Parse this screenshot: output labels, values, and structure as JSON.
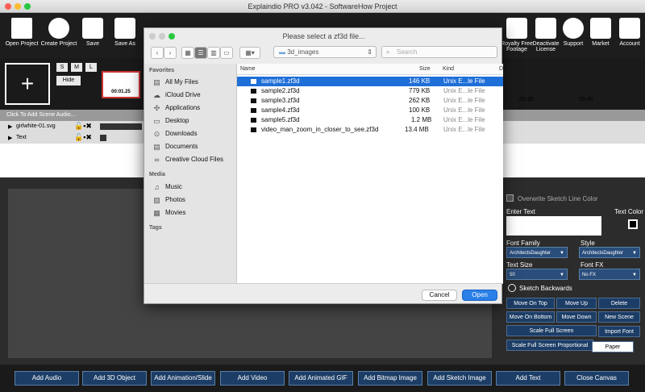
{
  "window": {
    "title": "Explaindio PRO v3.042 - SoftwareHow Project"
  },
  "toolbar": {
    "left": [
      {
        "label": "Open Project"
      },
      {
        "label": "Create Project"
      },
      {
        "label": "Save"
      },
      {
        "label": "Save As"
      }
    ],
    "right": [
      {
        "label": "Royalty Free Footage"
      },
      {
        "label": "Deactivate License"
      },
      {
        "label": "Support"
      },
      {
        "label": "Market"
      },
      {
        "label": "Account"
      }
    ]
  },
  "timeline": {
    "size_buttons": [
      "S",
      "M",
      "L"
    ],
    "hide_label": "Hide",
    "thumb_time": "00:01.25",
    "audio_row": "Click To Add Scene Audio...",
    "tracks": [
      {
        "name": "girlwhite-01.svg"
      },
      {
        "name": "Text"
      }
    ],
    "ruler": [
      "00:35",
      "00:40"
    ]
  },
  "dialog": {
    "title": "Please select a zf3d file...",
    "folder": "3d_images",
    "search_placeholder": "Search",
    "sidebar": {
      "favorites_heading": "Favorites",
      "favorites": [
        {
          "label": "All My Files",
          "icon": "all-files-icon"
        },
        {
          "label": "iCloud Drive",
          "icon": "cloud-icon"
        },
        {
          "label": "Applications",
          "icon": "applications-icon"
        },
        {
          "label": "Desktop",
          "icon": "desktop-icon"
        },
        {
          "label": "Downloads",
          "icon": "downloads-icon"
        },
        {
          "label": "Documents",
          "icon": "documents-icon"
        },
        {
          "label": "Creative Cloud Files",
          "icon": "creative-cloud-icon"
        }
      ],
      "media_heading": "Media",
      "media": [
        {
          "label": "Music",
          "icon": "music-icon"
        },
        {
          "label": "Photos",
          "icon": "photos-icon"
        },
        {
          "label": "Movies",
          "icon": "movies-icon"
        }
      ],
      "tags_heading": "Tags"
    },
    "columns": {
      "name": "Name",
      "size": "Size",
      "kind": "Kind",
      "date": "D"
    },
    "files": [
      {
        "name": "sample1.zf3d",
        "size": "146 KB",
        "kind": "Unix E...le File"
      },
      {
        "name": "sample2.zf3d",
        "size": "779 KB",
        "kind": "Unix E...le File"
      },
      {
        "name": "sample3.zf3d",
        "size": "262 KB",
        "kind": "Unix E...le File"
      },
      {
        "name": "sample4.zf3d",
        "size": "100 KB",
        "kind": "Unix E...le File"
      },
      {
        "name": "sample5.zf3d",
        "size": "1.2 MB",
        "kind": "Unix E...le File"
      },
      {
        "name": "video_man_zoom_in_closer_to_see.zf3d",
        "size": "13.4 MB",
        "kind": "Unix E...le File"
      }
    ],
    "cancel_label": "Cancel",
    "open_label": "Open"
  },
  "panel": {
    "overwrite_label": "Overwrite Sketch Line Color",
    "enter_text_label": "Enter Text",
    "text_color_label": "Text Color",
    "font_family_label": "Font Family",
    "font_family_value": "ArchitectsDaughter",
    "style_label": "Style",
    "style_value": "ArchitectsDaughter",
    "text_size_label": "Text Size",
    "text_size_value": "50",
    "font_fx_label": "Font FX",
    "font_fx_value": "No FX",
    "sketch_backwards_label": "Sketch Backwards",
    "buttons": [
      "Move On Top",
      "Move Up",
      "Delete",
      "Move On Bottom",
      "Move Down",
      "New Scene",
      "Scale Full Screen",
      "Import Font",
      "Scale Full Screen Proportional",
      "Paper"
    ]
  },
  "bottom": {
    "buttons": [
      "Add Audio",
      "Add 3D Object",
      "Add Animation/Slide",
      "Add Video",
      "Add Animated GIF",
      "Add Bitmap Image",
      "Add Sketch Image",
      "Add Text",
      "Close Canvas"
    ]
  },
  "colors": {
    "accent": "#1f6fd8",
    "button_blue": "#1c3d66"
  }
}
